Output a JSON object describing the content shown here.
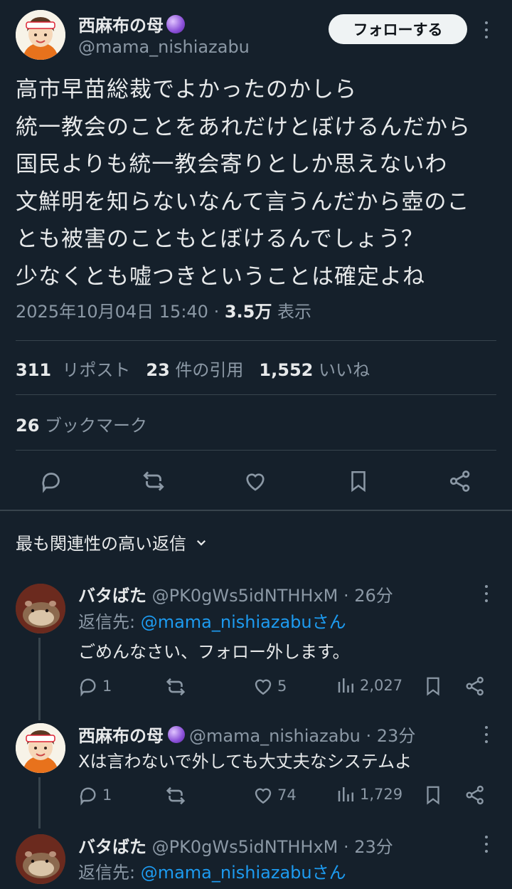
{
  "author": {
    "name": "西麻布の母",
    "handle": "@mama_nishiazabu",
    "avatar_label": "大和魂",
    "follow_label": "フォローする"
  },
  "tweet": {
    "lines": [
      "高市早苗総裁でよかったのかしら",
      "統一教会のことをあれだけとぼけるんだから",
      "国民よりも統一教会寄りとしか思えないわ",
      "文鮮明を知らないなんて言うんだから壺のこ",
      "とも被害のこともとぼけるんでしょう？",
      "少なくとも嘘つきということは確定よね"
    ],
    "datetime": "2025年10月04日 15:40 · ",
    "views_count": "3.5万",
    "views_label": " 表示"
  },
  "stats": {
    "reposts": "311",
    "reposts_label": "リポスト",
    "quotes": "23",
    "quotes_label": "件の引用",
    "likes": "1,552",
    "likes_label": "いいね",
    "bookmarks": "26",
    "bookmarks_label": "ブックマーク"
  },
  "actions": [
    "reply-icon",
    "retweet-icon",
    "heart-icon",
    "bookmark-icon",
    "share-icon"
  ],
  "sort": {
    "label": "最も関連性の高い返信"
  },
  "replies": [
    {
      "name": "バタばた",
      "handle": "@PK0gWs5idNTHHxM · 26分",
      "replying_prefix": "返信先: ",
      "replying_handle": "@mama_nishiazabu",
      "replying_suffix": "さん",
      "text": "ごめんなさい、フォロー外します。",
      "reply_count": "1",
      "retweet_count": "",
      "like_count": "5",
      "view_count": "2,027"
    },
    {
      "name": "西麻布の母",
      "handle": "@mama_nishiazabu · 23分",
      "text": "Xは言わないで外しても大丈夫なシステムよ",
      "reply_count": "1",
      "retweet_count": "",
      "like_count": "74",
      "view_count": "1,729"
    },
    {
      "name": "バタばた",
      "handle": "@PK0gWs5idNTHHxM · 23分",
      "replying_prefix": "返信先: ",
      "replying_handle": "@mama_nishiazabu",
      "replying_suffix": "さん"
    }
  ],
  "colors": {
    "background": "#15202b",
    "link": "#1d9bf0",
    "muted": "#8b98a5",
    "divider": "#38444d"
  }
}
